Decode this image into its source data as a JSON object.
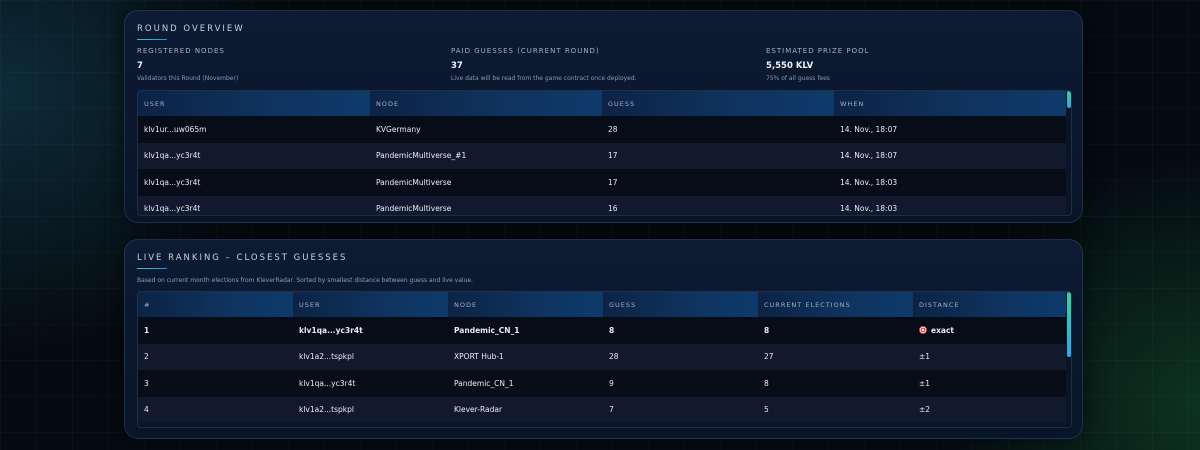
{
  "overview": {
    "title": "Round Overview",
    "stats": [
      {
        "label": "Registered Nodes",
        "value": "7",
        "sub": "Validators this Round (November)"
      },
      {
        "label": "Paid Guesses (Current Round)",
        "value": "37",
        "sub": "Live data will be read from the game contract once deployed."
      },
      {
        "label": "Estimated Prize Pool",
        "value": "5,550 KLV",
        "sub": "75% of all guess fees"
      }
    ],
    "columns": [
      "User",
      "Node",
      "Guess",
      "When"
    ],
    "rows": [
      {
        "user": "klv1ur...uw065m",
        "node": "KVGermany",
        "guess": "28",
        "when": "14. Nov., 18:07"
      },
      {
        "user": "klv1qa...yc3r4t",
        "node": "PandemicMultiverse_#1",
        "guess": "17",
        "when": "14. Nov., 18:07"
      },
      {
        "user": "klv1qa...yc3r4t",
        "node": "PandemicMultiverse",
        "guess": "17",
        "when": "14. Nov., 18:03"
      },
      {
        "user": "klv1qa...yc3r4t",
        "node": "PandemicMultiverse",
        "guess": "16",
        "when": "14. Nov., 18:03"
      }
    ]
  },
  "ranking": {
    "title": "Live Ranking – Closest Guesses",
    "subtitle": "Based on current month elections from KleverRadar. Sorted by smallest distance between guess and live value.",
    "columns": [
      "#",
      "User",
      "Node",
      "Guess",
      "Current Elections",
      "Distance"
    ],
    "rows": [
      {
        "rank": "1",
        "user": "klv1qa...yc3r4t",
        "node": "Pandemic_CN_1",
        "guess": "8",
        "elections": "8",
        "distance": "exact"
      },
      {
        "rank": "2",
        "user": "klv1a2...tspkpl",
        "node": "XPORT Hub-1",
        "guess": "28",
        "elections": "27",
        "distance": "±1"
      },
      {
        "rank": "3",
        "user": "klv1qa...yc3r4t",
        "node": "Pandemic_CN_1",
        "guess": "9",
        "elections": "8",
        "distance": "±1"
      },
      {
        "rank": "4",
        "user": "klv1a2...tspkpl",
        "node": "Klever-Radar",
        "guess": "7",
        "elections": "5",
        "distance": "±2"
      }
    ],
    "exact_icon": "target-icon"
  },
  "colors": {
    "accent_start": "#2fd3a5",
    "accent_end": "#2a8ed9",
    "card_bg": "#0d1a33",
    "header_bg": "#0f3460"
  }
}
